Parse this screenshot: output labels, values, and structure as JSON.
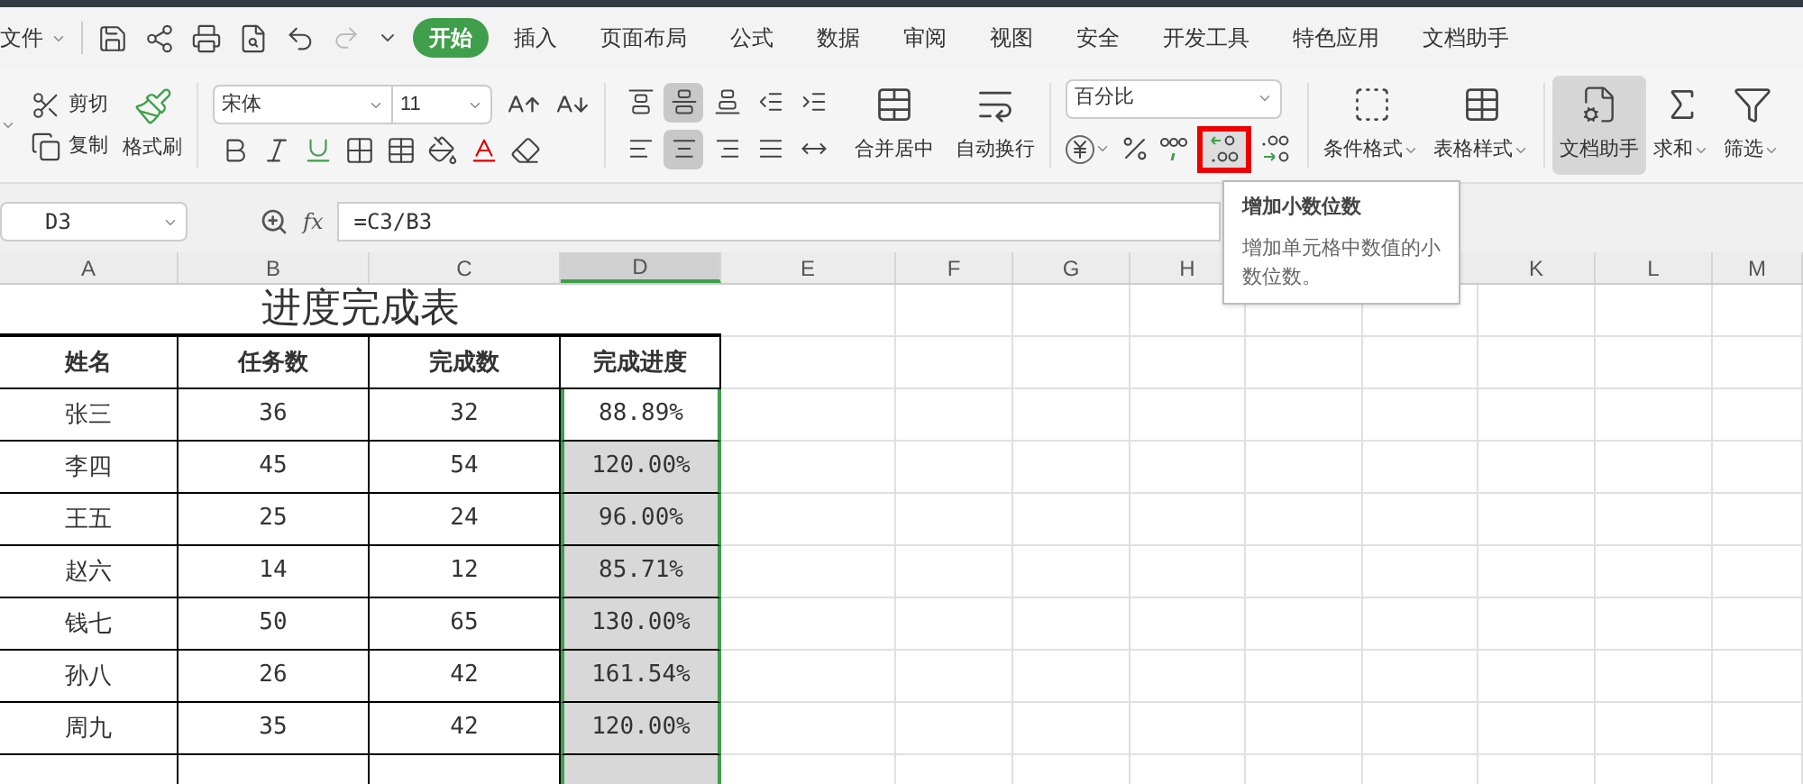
{
  "menu": {
    "file_label": "文件"
  },
  "tabs": [
    {
      "label": "开始",
      "selected": true
    },
    {
      "label": "插入",
      "selected": false
    },
    {
      "label": "页面布局",
      "selected": false
    },
    {
      "label": "公式",
      "selected": false
    },
    {
      "label": "数据",
      "selected": false
    },
    {
      "label": "审阅",
      "selected": false
    },
    {
      "label": "视图",
      "selected": false
    },
    {
      "label": "安全",
      "selected": false
    },
    {
      "label": "开发工具",
      "selected": false
    },
    {
      "label": "特色应用",
      "selected": false
    },
    {
      "label": "文档助手",
      "selected": false
    }
  ],
  "ribbon": {
    "cut": "剪切",
    "copy": "复制",
    "format_painter": "格式刷",
    "font": "宋体",
    "font_size": "11",
    "align_buttons": [
      {
        "kind": "top",
        "selected": false
      },
      {
        "kind": "middle",
        "selected": true
      },
      {
        "kind": "bottom",
        "selected": false
      },
      {
        "kind": "outdent",
        "selected": false
      },
      {
        "kind": "indent",
        "selected": false
      },
      {
        "kind": "left",
        "selected": false
      },
      {
        "kind": "center",
        "selected": true
      },
      {
        "kind": "right",
        "selected": false
      },
      {
        "kind": "justify",
        "selected": false
      },
      {
        "kind": "distribute",
        "selected": false
      }
    ],
    "merge": "合并居中",
    "wrap": "自动换行",
    "number_format": "百分比",
    "increase_decimal_highlighted": true,
    "conditional_format": "条件格式",
    "table_style": "表格样式",
    "doc_assistant": {
      "label": "文档助手",
      "selected": true
    },
    "sum": "求和",
    "filter": "筛选"
  },
  "formula_bar": {
    "cell": "D3",
    "fx": "fx",
    "formula": "=C3/B3"
  },
  "tooltip": {
    "title": "增加小数位数",
    "text": "增加单元格中数值的小数位数。"
  },
  "columns": [
    {
      "label": "A",
      "selected": false
    },
    {
      "label": "B",
      "selected": false
    },
    {
      "label": "C",
      "selected": false
    },
    {
      "label": "D",
      "selected": true
    },
    {
      "label": "E",
      "selected": false
    },
    {
      "label": "F",
      "selected": false
    },
    {
      "label": "G",
      "selected": false
    },
    {
      "label": "H",
      "selected": false
    },
    {
      "label": "K",
      "selected": false
    },
    {
      "label": "L",
      "selected": false
    },
    {
      "label": "M",
      "selected": false
    }
  ],
  "table": {
    "title": "进度完成表",
    "headers": [
      "姓名",
      "任务数",
      "完成数",
      "完成进度"
    ],
    "rows": [
      {
        "cells": [
          "张三",
          "36",
          "32",
          "88.89%"
        ],
        "selected": false
      },
      {
        "cells": [
          "李四",
          "45",
          "54",
          "120.00%"
        ],
        "selected": true
      },
      {
        "cells": [
          "王五",
          "25",
          "24",
          "96.00%"
        ],
        "selected": true
      },
      {
        "cells": [
          "赵六",
          "14",
          "12",
          "85.71%"
        ],
        "selected": true
      },
      {
        "cells": [
          "钱七",
          "50",
          "65",
          "130.00%"
        ],
        "selected": true
      },
      {
        "cells": [
          "孙八",
          "26",
          "42",
          "161.54%"
        ],
        "selected": true
      },
      {
        "cells": [
          "周九",
          "35",
          "42",
          "120.00%"
        ],
        "selected": true
      },
      {
        "selected": true
      }
    ]
  }
}
